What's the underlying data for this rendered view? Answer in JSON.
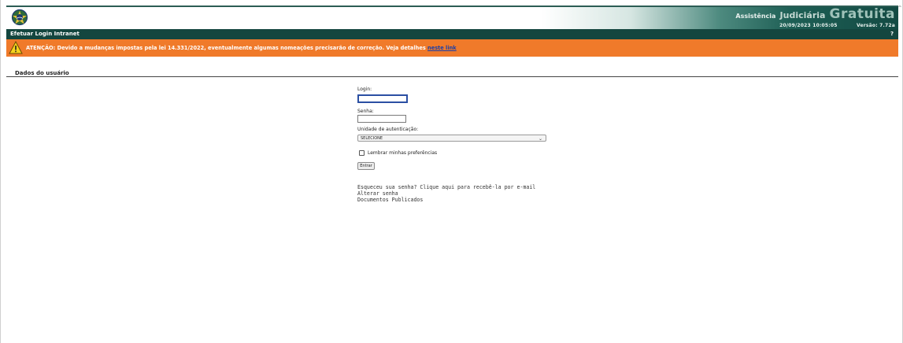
{
  "header": {
    "brand_small": "Assistência",
    "brand_mid": "Judiciária",
    "brand_big": "Gratuita",
    "datetime": "20/09/2023 10:05:05",
    "version": "Versão: 7.72a",
    "colors": {
      "dark_green": "#14463f",
      "brand_green": "#1e5f55"
    }
  },
  "titlebar": {
    "title": "Efetuar Login Intranet",
    "help_label": "?"
  },
  "warning": {
    "text": "ATENÇÃO: Devido a mudanças impostas pela lei 14.331/2022, eventualmente algumas nomeações precisarão de correção. Veja detalhes",
    "link": "neste link",
    "color": "#f07a2a",
    "icon": "warning-triangle-icon"
  },
  "section": {
    "title": "Dados do usuário"
  },
  "form": {
    "login_label": "Login:",
    "login_value": "",
    "senha_label": "Senha:",
    "senha_value": "",
    "unidade_label": "Unidade de autenticação:",
    "unidade_selected": "SELECIONE",
    "remember_label": "Lembrar minhas preferências",
    "submit_label": "Entrar"
  },
  "links": {
    "forgot": "Esqueceu sua senha? Clique aqui para recebê-la por e-mail",
    "change": "Alterar senha",
    "docs": "Documentos Publicados"
  }
}
